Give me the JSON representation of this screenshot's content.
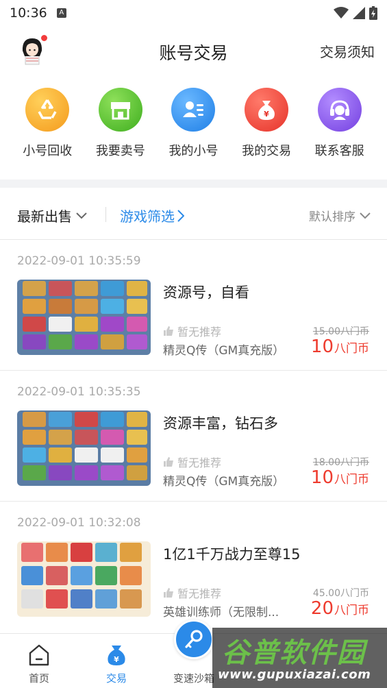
{
  "status_bar": {
    "time": "10:36",
    "notification_icon": "A"
  },
  "header": {
    "title": "账号交易",
    "notice": "交易须知"
  },
  "quick_menu": [
    {
      "label": "小号回收",
      "icon": "recycle-icon",
      "color": "#f9a52a"
    },
    {
      "label": "我要卖号",
      "icon": "shop-icon",
      "color": "#5cc23a"
    },
    {
      "label": "我的小号",
      "icon": "user-card-icon",
      "color": "#2e8ff0"
    },
    {
      "label": "我的交易",
      "icon": "money-bag-icon",
      "color": "#f04a3a"
    },
    {
      "label": "联系客服",
      "icon": "headset-icon",
      "color": "#8a55ee"
    }
  ],
  "filter": {
    "latest": "最新出售",
    "game_filter": "游戏筛选",
    "sort": "默认排序"
  },
  "listings": [
    {
      "time": "2022-09-01 10:35:59",
      "title": "资源号，自看",
      "recommend": "暂无推荐",
      "game": "精灵Q传（GM真充版）",
      "original_price": "15.00八门币",
      "price": "10",
      "unit": "八门币",
      "struck": true
    },
    {
      "time": "2022-09-01 10:35:35",
      "title": "资源丰富，钻石多",
      "recommend": "暂无推荐",
      "game": "精灵Q传（GM真充版）",
      "original_price": "18.00八门币",
      "price": "10",
      "unit": "八门币",
      "struck": true
    },
    {
      "time": "2022-09-01 10:32:08",
      "title": "1亿1千万战力至尊15",
      "recommend": "暂无推荐",
      "game": "英雄训练师（无限制...",
      "original_price": "45.00八门币",
      "price": "20",
      "unit": "八门币",
      "struck": false
    }
  ],
  "tabbar": {
    "home": "首页",
    "trade": "交易",
    "sandbox": "变速沙箱"
  },
  "watermark": {
    "title": "谷普软件园",
    "url": "www.gupuxiazai.com"
  },
  "colors": {
    "accent": "#2b8ae8",
    "price": "#ee3b2e"
  }
}
